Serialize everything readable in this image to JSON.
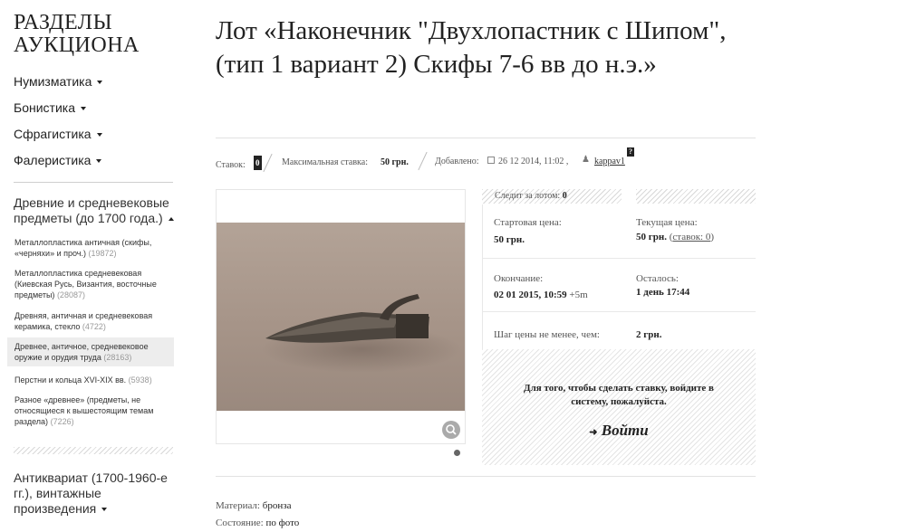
{
  "sidebar": {
    "heading": "РАЗДЕЛЫ АУКЦИОНА",
    "categories": [
      {
        "label": "Нумизматика"
      },
      {
        "label": "Бонистика"
      },
      {
        "label": "Сфрагистика"
      },
      {
        "label": "Фалеристика"
      }
    ],
    "expanded": {
      "label": "Древние и средневековые предметы (до 1700 года.)",
      "items": [
        {
          "label": "Металлопластика античная (скифы, «черняхи» и проч.)",
          "count": "(19872)"
        },
        {
          "label": "Металлопластика средневековая (Киевская Русь, Византия, восточные предметы)",
          "count": "(28087)"
        },
        {
          "label": "Древняя, античная и средневековая керамика, стекло",
          "count": "(4722)"
        },
        {
          "label": "Древнее, античное, средневековое оружие и орудия труда",
          "count": "(28163)"
        },
        {
          "label": "Перстни и кольца XVI-XIX вв.",
          "count": "(5938)"
        },
        {
          "label": "Разное «древнее» (предметы, не относящиеся к вышестоящим темам раздела)",
          "count": "(7226)"
        }
      ]
    },
    "antique": {
      "label": "Антиквариат (1700-1960-е гг.), винтажные произведения"
    }
  },
  "lot": {
    "title": "Лот «Наконечник \"Двухлопастник с Шипом\", (тип 1 вариант 2) Скифы 7-6 вв до н.э.»",
    "bids_label": "Ставок:",
    "bids_count": "0",
    "max_bid_label": "Максимальная ставка:",
    "max_bid_value": "50 грн.",
    "added_label": "Добавлено:",
    "added_value": "26 12 2014, 11:02 ,",
    "seller": "kappav1",
    "seller_badge": "?",
    "watching_label": "Следит за лотом:",
    "watching_count": "0",
    "start_price_label": "Стартовая цена:",
    "start_price": "50 грн.",
    "current_price_label": "Текущая цена:",
    "current_price": "50 грн.",
    "current_bids_link": "ставок: 0",
    "end_label": "Окончание:",
    "end_value": "02 01 2015, 10:59",
    "end_extra": "+5m",
    "remaining_label": "Осталось:",
    "remaining_value": "1 день 17:44",
    "step_label": "Шаг цены не менее, чем:",
    "step_value": "2 грн.",
    "login_message": "Для того, чтобы сделать ставку, войдите в систему, пожалуйста.",
    "login_button": "Войти",
    "material_label": "Материал:",
    "material_value": "бронза",
    "condition_label": "Состояние:",
    "condition_value": "по фото"
  },
  "colors": {
    "photo_bg": "#a9998d",
    "accent": "#222222"
  }
}
